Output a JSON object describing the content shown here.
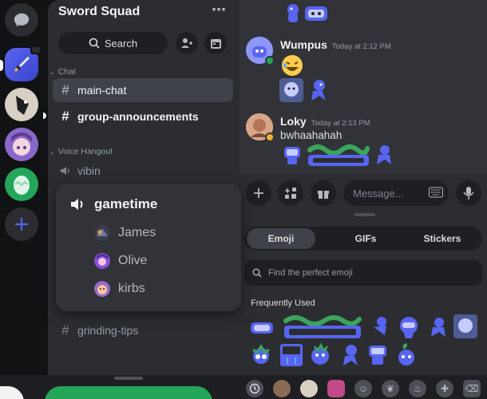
{
  "guild": {
    "name": "Sword Squad"
  },
  "channel_list": {
    "search_label": "Search",
    "categories": [
      {
        "name": "Chat"
      },
      {
        "name": "Voice Hangout"
      }
    ],
    "channels": {
      "main_chat": "main-chat",
      "group_announcements": "group-announcements",
      "vibin": "vibin",
      "grinding_tips": "grinding-tips"
    }
  },
  "voice_popup": {
    "title": "gametime",
    "users": [
      {
        "name": "James"
      },
      {
        "name": "Olive"
      },
      {
        "name": "kirbs"
      }
    ]
  },
  "messages": [
    {
      "author": "Wumpus",
      "time": "Today at 2:12 PM",
      "text": ""
    },
    {
      "author": "Loky",
      "time": "Today at 2:13 PM",
      "text": "bwhaahahah"
    }
  ],
  "composer": {
    "placeholder": "Message..."
  },
  "emoji_picker": {
    "tabs": [
      "Emoji",
      "GIFs",
      "Stickers"
    ],
    "search_placeholder": "Find the perfect emoji",
    "section_label": "Frequently Used"
  },
  "colors": {
    "blurple": "#5865f2",
    "green": "#23a55a",
    "background": "#313338"
  }
}
